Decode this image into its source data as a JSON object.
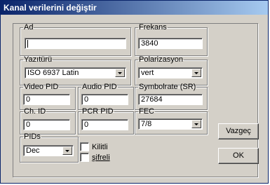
{
  "window": {
    "title": "Kanal verilerini değiştir"
  },
  "fields": {
    "ad": {
      "label": "Ad",
      "value": ""
    },
    "frekans": {
      "label": "Frekans",
      "value": "3840"
    },
    "yazituru": {
      "label": "Yazıtürü",
      "value": "ISO 6937 Latin"
    },
    "polarizasyon": {
      "label": "Polarizasyon",
      "value": "vert"
    },
    "video_pid": {
      "label": "Video PID",
      "value": "0"
    },
    "audio_pid": {
      "label": "Audio PID",
      "value": "0"
    },
    "symbolrate": {
      "label": "Symbolrate (SR)",
      "value": "27684"
    },
    "ch_id": {
      "label": "Ch. ID",
      "value": "0"
    },
    "pcr_pid": {
      "label": "PCR PID",
      "value": "0"
    },
    "fec": {
      "label": "FEC",
      "value": "7/8"
    },
    "pids": {
      "label": "PIDs",
      "value": "Dec"
    }
  },
  "checkboxes": {
    "kilitli": {
      "label": "Kilitli",
      "checked": false
    },
    "sifreli": {
      "label": "şifreli",
      "checked": false
    }
  },
  "buttons": {
    "cancel": "Vazgeç",
    "ok": "OK"
  }
}
